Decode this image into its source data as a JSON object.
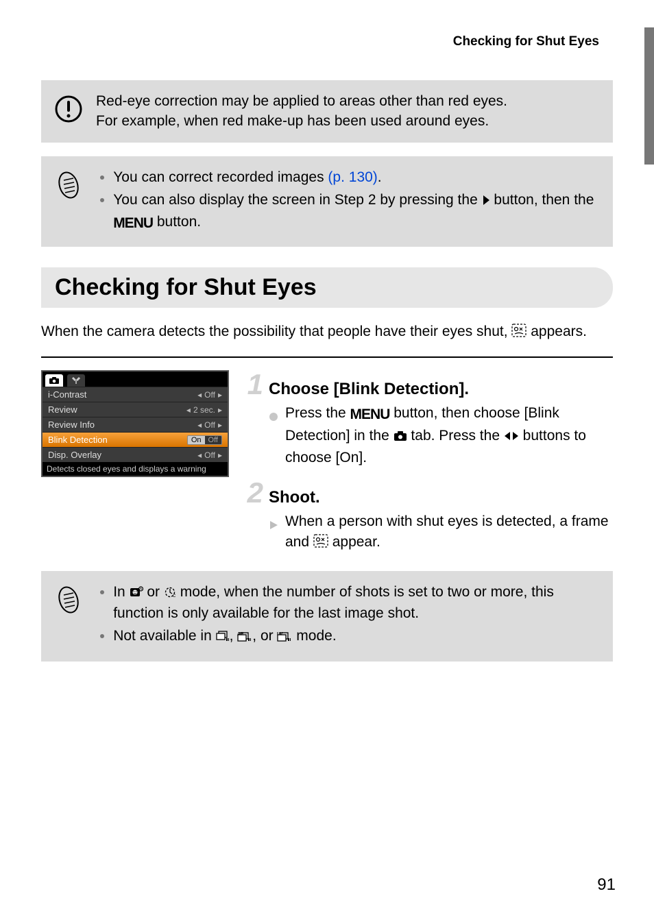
{
  "header": {
    "running_title": "Checking for Shut Eyes"
  },
  "callouts": {
    "caution": {
      "line1": "Red-eye correction may be applied to areas other than red eyes.",
      "line2": "For example, when red make-up has been used around eyes."
    },
    "tip1": {
      "item1_pre": "You can correct recorded images ",
      "item1_link": "(p. 130)",
      "item1_post": ".",
      "item2_pre": "You can also display the screen in Step 2 by pressing the ",
      "item2_mid": " button, then the ",
      "item2_post": " button."
    },
    "tip2": {
      "item1_pre": "In ",
      "item1_mid1": " or ",
      "item1_mid2": " mode, when the number of shots is set to two or more, this function is only available for the last image shot.",
      "item2_pre": "Not available in ",
      "item2_sep": ", ",
      "item2_or": ", or ",
      "item2_post": " mode."
    }
  },
  "section": {
    "title": "Checking for Shut Eyes",
    "intro_pre": "When the camera detects the possibility that people have their eyes shut, ",
    "intro_post": " appears."
  },
  "menu": {
    "rows": [
      {
        "label": "i-Contrast",
        "value": "Off"
      },
      {
        "label": "Review",
        "value": "2 sec."
      },
      {
        "label": "Review Info",
        "value": "Off"
      },
      {
        "label": "Blink Detection",
        "value_on": "On",
        "value_off": "Off"
      },
      {
        "label": "Disp. Overlay",
        "value": "Off"
      }
    ],
    "footer": "Detects closed eyes and displays a warning"
  },
  "steps": {
    "s1": {
      "num": "1",
      "title": "Choose [Blink Detection].",
      "body_pre": "Press the ",
      "body_mid1": " button, then choose [Blink Detection] in the ",
      "body_mid2": " tab. Press the ",
      "body_post": " buttons to choose [On]."
    },
    "s2": {
      "num": "2",
      "title": "Shoot.",
      "body_pre": "When a person with shut eyes is detected, a frame and ",
      "body_post": " appear."
    }
  },
  "page_number": "91",
  "glyph_text": {
    "menu_label": "MENU"
  }
}
